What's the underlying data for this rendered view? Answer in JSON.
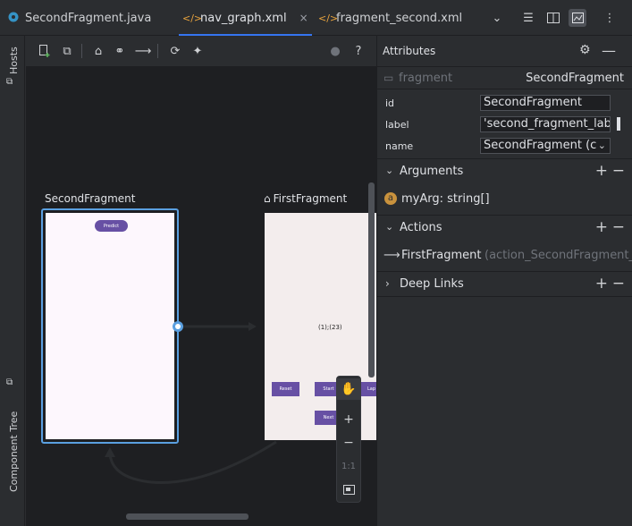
{
  "tabs": [
    {
      "label": "SecondFragment.java",
      "icon": "java-file-icon"
    },
    {
      "label": "nav_graph.xml",
      "icon": "xml-file-icon"
    },
    {
      "label": "fragment_second.xml",
      "icon": "xml-file-icon"
    }
  ],
  "tab_close": "×",
  "left_strip": {
    "hosts": "Hosts",
    "component_tree": "Component Tree"
  },
  "graph": {
    "second_fragment": {
      "label": "SecondFragment",
      "button": "Predict"
    },
    "first_fragment": {
      "label": "FirstFragment",
      "count_text": "(1);(23)",
      "buttons": [
        "Reset",
        "Start",
        "Lap",
        "Next"
      ]
    }
  },
  "zoom": {
    "fit_label": "1:1"
  },
  "attributes": {
    "title": "Attributes",
    "type": "fragment",
    "class_name": "SecondFragment",
    "rows": [
      {
        "key": "id",
        "value": "SecondFragment"
      },
      {
        "key": "label",
        "value": "'second_fragment_labe"
      },
      {
        "key": "name",
        "value": "SecondFragment (c"
      }
    ],
    "sections": {
      "arguments": "Arguments",
      "actions": "Actions",
      "deep_links": "Deep Links"
    },
    "argument": {
      "badge": "a",
      "text": "myArg: string[]"
    },
    "action": {
      "dest": "FirstFragment",
      "id": "(action_SecondFragment_"
    }
  },
  "colors": {
    "accent": "#3574f0",
    "selection": "#5a9fe0",
    "button": "#6750a4"
  }
}
